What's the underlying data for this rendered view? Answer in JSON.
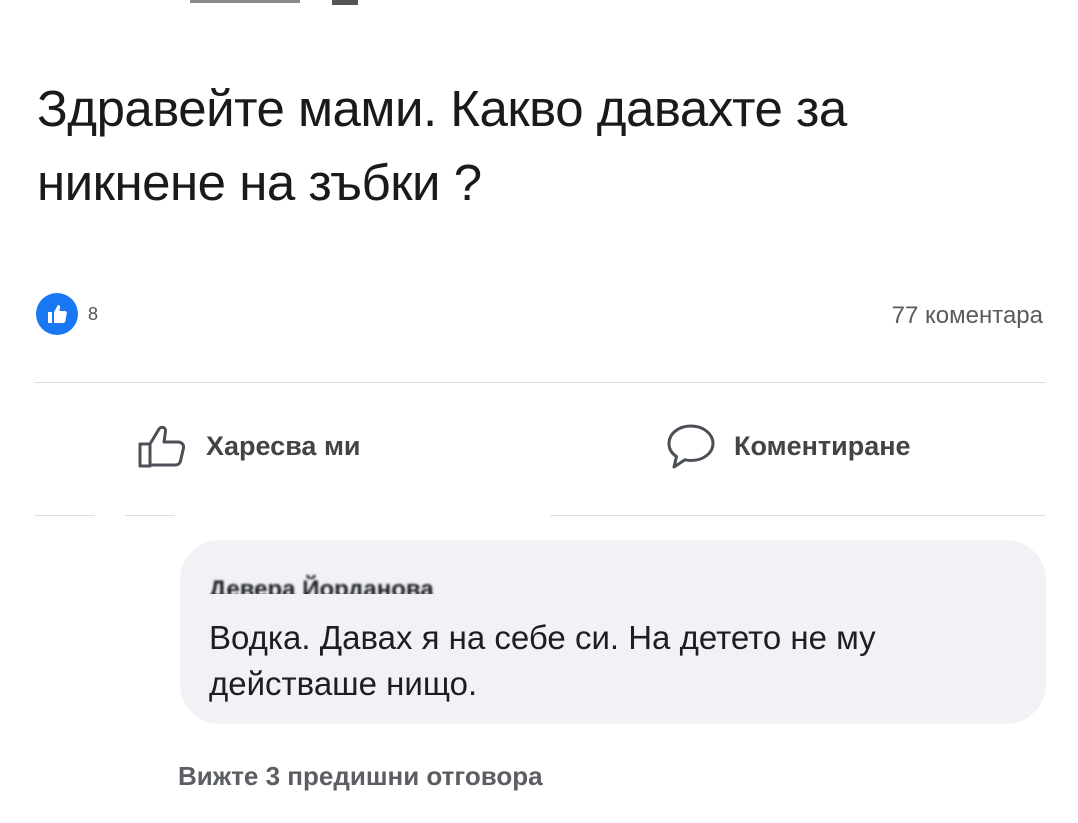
{
  "post": {
    "text": "Здравейте мами. Какво давахте за никнене на зъбки ?",
    "reaction_count": "8",
    "comment_count": "77 коментара",
    "reaction_icon": "thumbs-up-icon"
  },
  "actions": {
    "like_label": "Харесва ми",
    "comment_label": "Коментиране"
  },
  "comment": {
    "author": "Деверa Йорданова",
    "text": "Водка. Давах я на себе си. На детето не му действаше нищо."
  },
  "replies": {
    "view_previous_label": "Вижте 3 предишни отговора"
  },
  "colors": {
    "accent": "#1877f2",
    "bubble": "#f0f2f5",
    "divider": "#dadde1",
    "muted_text": "#5b5e63"
  }
}
